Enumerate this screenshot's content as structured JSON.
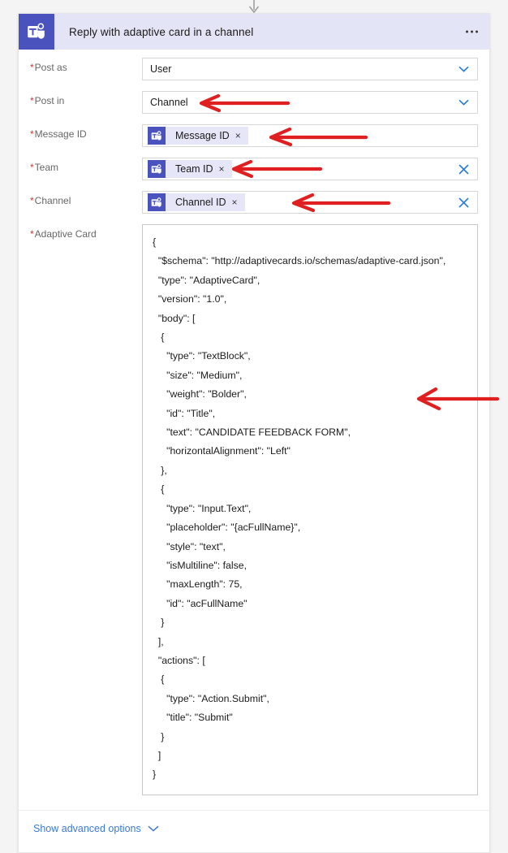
{
  "app": {
    "title": "Reply with adaptive card in a channel",
    "icon": "teams-icon",
    "menu_icon": "more-options-icon",
    "accent_purple": "#4a52bd",
    "header_bg": "#e3e4f5",
    "link_blue": "#3b78d8",
    "required_red": "#d13438",
    "annotation_red": "#e02020"
  },
  "fields": [
    {
      "label": "Post as",
      "required": true,
      "type": "dropdown",
      "value": "User",
      "right_icon": "chevron-down-icon"
    },
    {
      "label": "Post in",
      "required": true,
      "type": "dropdown",
      "value": "Channel",
      "right_icon": "chevron-down-icon"
    },
    {
      "label": "Message ID",
      "required": true,
      "type": "token",
      "token_label": "Message ID",
      "token_icon": "teams-icon",
      "token_remove": "×",
      "right_icon": "none"
    },
    {
      "label": "Team",
      "required": true,
      "type": "token",
      "token_label": "Team ID",
      "token_icon": "teams-icon",
      "token_remove": "×",
      "right_icon": "clear-x-icon"
    },
    {
      "label": "Channel",
      "required": true,
      "type": "token",
      "token_label": "Channel ID",
      "token_icon": "teams-icon",
      "token_remove": "×",
      "right_icon": "clear-x-icon"
    }
  ],
  "adaptive_card": {
    "label": "Adaptive Card",
    "required": true,
    "lines": [
      "{",
      "  \"$schema\": \"http://adaptivecards.io/schemas/adaptive-card.json\",",
      "  \"type\": \"AdaptiveCard\",",
      "  \"version\": \"1.0\",",
      "  \"body\": [",
      "   {",
      "     \"type\": \"TextBlock\",",
      "     \"size\": \"Medium\",",
      "     \"weight\": \"Bolder\",",
      "     \"id\": \"Title\",",
      "     \"text\": \"CANDIDATE FEEDBACK FORM\",",
      "     \"horizontalAlignment\": \"Left\"",
      "   },",
      "   {",
      "     \"type\": \"Input.Text\",",
      "     \"placeholder\": \"{acFullName}\",",
      "     \"style\": \"text\",",
      "     \"isMultiline\": false,",
      "     \"maxLength\": 75,",
      "     \"id\": \"acFullName\"",
      "   }",
      "  ],",
      "  \"actions\": [",
      "   {",
      "     \"type\": \"Action.Submit\",",
      "     \"title\": \"Submit\"",
      "   }",
      "  ]",
      "}"
    ]
  },
  "footer": {
    "advanced_options_label": "Show advanced options",
    "chevron": "chevron-down-icon"
  },
  "annotations": [
    {
      "name": "arrow-post-in",
      "points_to": "Post in"
    },
    {
      "name": "arrow-message-id",
      "points_to": "Message ID"
    },
    {
      "name": "arrow-team",
      "points_to": "Team"
    },
    {
      "name": "arrow-channel",
      "points_to": "Channel"
    },
    {
      "name": "arrow-adaptive-card",
      "points_to": "Adaptive Card"
    }
  ]
}
